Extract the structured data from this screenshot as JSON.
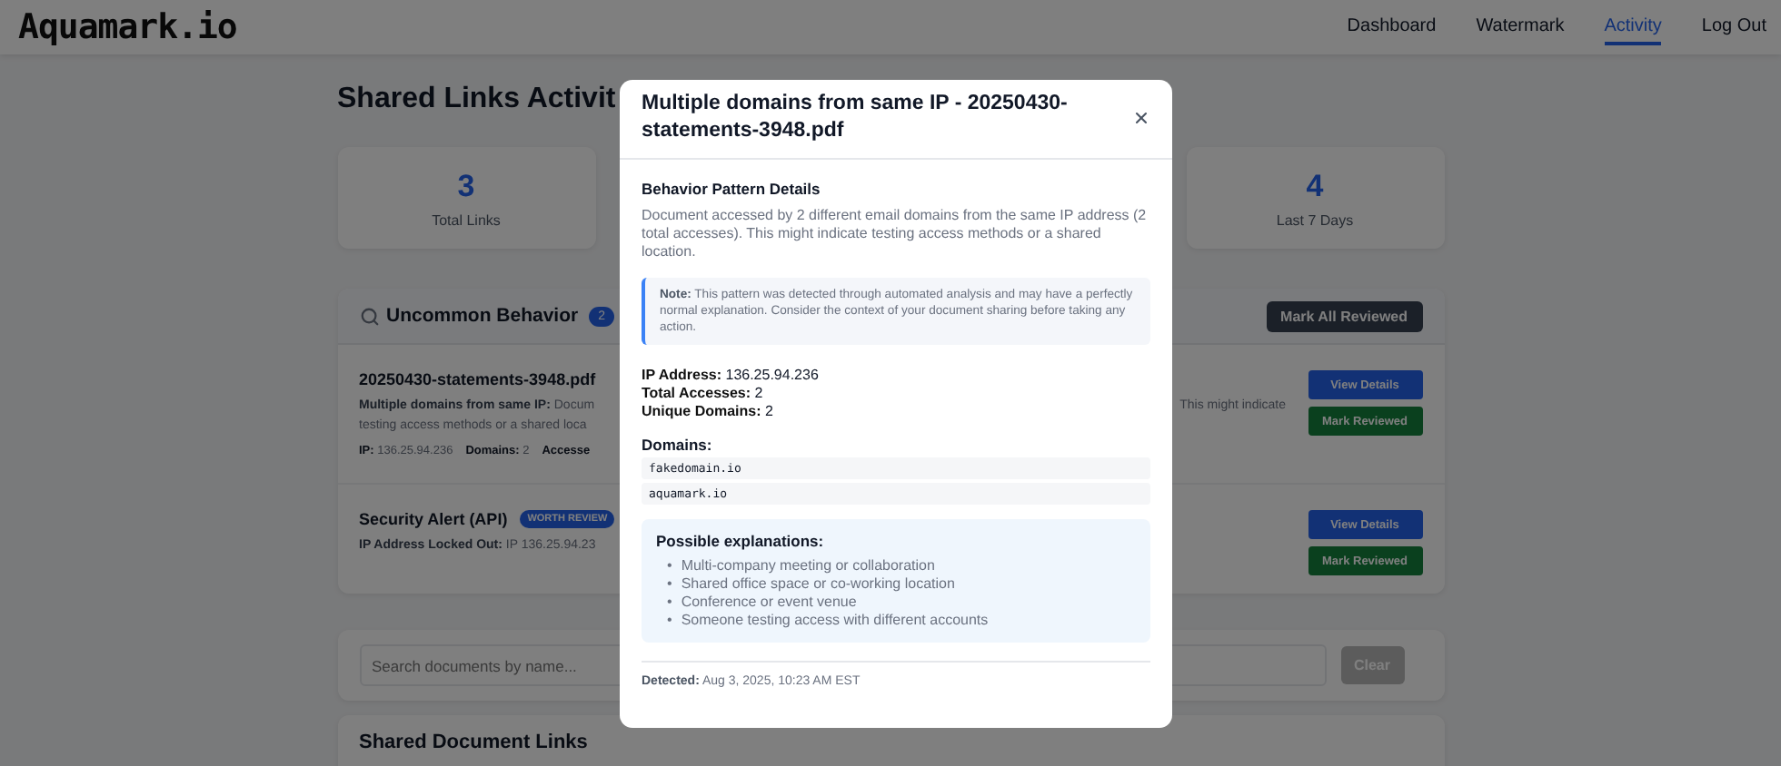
{
  "nav": {
    "logo": "Aquamark.io",
    "links": [
      {
        "label": "Dashboard",
        "selected": false
      },
      {
        "label": "Watermark",
        "selected": false
      },
      {
        "label": "Activity",
        "selected": true
      },
      {
        "label": "Log Out",
        "selected": false
      }
    ]
  },
  "page": {
    "title": "Shared Links Activit",
    "stats": [
      {
        "value": "3",
        "label": "Total Links"
      },
      {
        "value": "4",
        "label": "Last 7 Days"
      }
    ],
    "uncommon": {
      "title": "Uncommon Behavior",
      "count": "2",
      "mark_all": "Mark All Reviewed",
      "items": [
        {
          "title": "20250430-statements-3948.pdf",
          "description": [
            "**Multiple domains from same IP:** Docum",
            "testing access methods or a shared loca"
          ],
          "description_right": "This might indicate",
          "meta": [
            "**IP:** 136.25.94.236",
            "**Domains:** 2",
            "**Accesse**"
          ],
          "view": "View Details",
          "review": "Mark Reviewed"
        },
        {
          "title": "Security Alert (API)",
          "tag": "WORTH REVIEW",
          "description": [
            "**IP Address Locked Out:** IP 136.25.94.23"
          ],
          "view": "View Details",
          "review": "Mark Reviewed"
        }
      ]
    },
    "search": {
      "placeholder": "Search documents by name...",
      "clear": "Clear",
      "clear_disabled": true
    },
    "links_title": "Shared Document Links"
  },
  "modal": {
    "title": "Multiple domains from same IP - 20250430-statements-3948.pdf",
    "section_title": "Behavior Pattern Details",
    "description": "Document accessed by 2 different email domains from the same IP address (2 total accesses). This might indicate testing access methods or a shared location.",
    "note": "**Note:** This pattern was detected through automated analysis and may have a perfectly normal explanation. Consider the context of your document sharing before taking any action.",
    "facts": [
      "**IP Address:** 136.25.94.236",
      "**Total Accesses:** 2",
      "**Unique Domains:** 2"
    ],
    "domains_title": "Domains:",
    "domains": [
      "fakedomain.io",
      "aquamark.io"
    ],
    "explanations": {
      "title": "Possible explanations:",
      "bullet": "•",
      "items": [
        "Multi-company meeting or collaboration",
        "Shared office space or co-working location",
        "Conference or event venue",
        "Someone testing access with different accounts"
      ]
    },
    "detected": "**Detected:** Aug 3, 2025, 10:23 AM EST"
  }
}
